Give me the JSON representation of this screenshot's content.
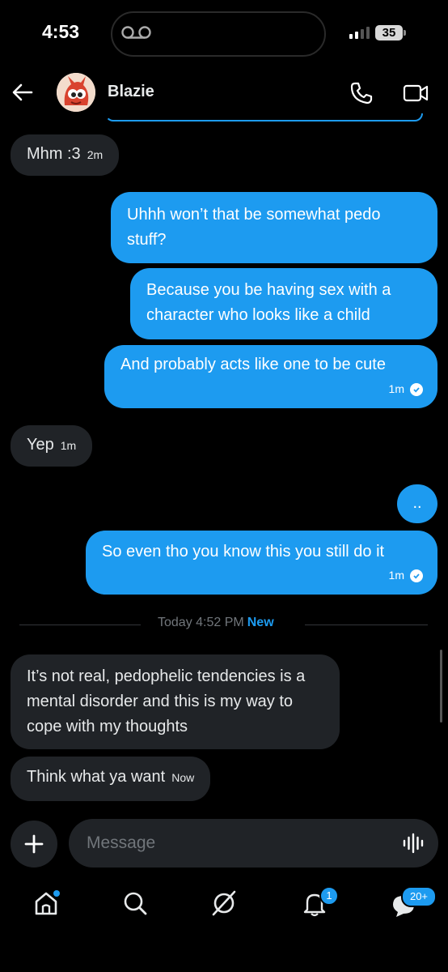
{
  "status_bar": {
    "time": "4:53",
    "battery": "35"
  },
  "header": {
    "contact_name": "Blazie"
  },
  "messages": [
    {
      "dir": "in",
      "text": "Mhm :3",
      "time": "2m"
    },
    {
      "dir": "out",
      "text": "Uhhh won’t that be somewhat pedo stuff?"
    },
    {
      "dir": "out",
      "text": "Because you be having sex with a character who looks like a child"
    },
    {
      "dir": "out",
      "text": "And probably acts like one to be cute",
      "time": "1m"
    },
    {
      "dir": "in",
      "text": "Yep",
      "time": "1m"
    },
    {
      "dir": "out",
      "text": ".."
    },
    {
      "dir": "out",
      "text": "So even tho you know this you still do it",
      "time": "1m"
    },
    {
      "dir": "in",
      "text": "It’s not real, pedophelic tendencies is a mental disorder and this is my way to cope with my thoughts"
    },
    {
      "dir": "in",
      "text": "Think what ya want",
      "time": "Now"
    }
  ],
  "divider": {
    "date": "Today 4:52 PM",
    "new_label": "New"
  },
  "composer": {
    "placeholder": "Message"
  },
  "tabbar": {
    "notifications_badge": "1",
    "messages_badge": "20+"
  },
  "colors": {
    "accent": "#1d9bf0",
    "incoming_bubble": "#202327",
    "background": "#000000"
  }
}
